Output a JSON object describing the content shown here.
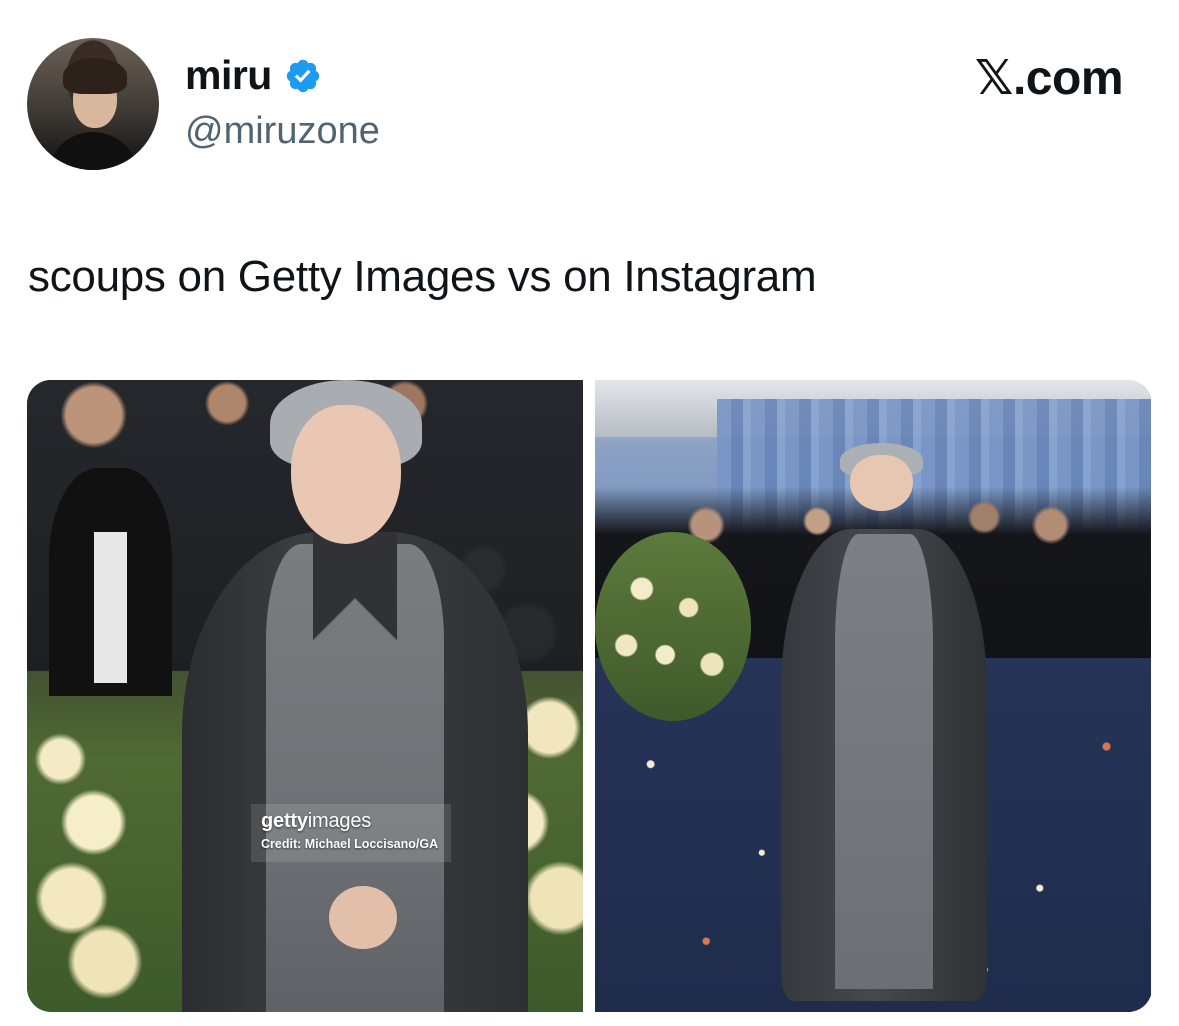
{
  "author": {
    "display_name": "miru",
    "handle": "@miruzone",
    "verified": true,
    "verified_color": "#1d9bf0"
  },
  "site": {
    "mark": "𝕏.com"
  },
  "tweet": {
    "text": "scoups on Getty Images vs on Instagram"
  },
  "media": {
    "left_photo": {
      "watermark_brand_bold": "getty",
      "watermark_brand_light": "images",
      "watermark_credit": "Credit: Michael Loccisano/GA"
    }
  },
  "colors": {
    "text_primary": "#0f1419",
    "text_secondary": "#536471",
    "background": "#ffffff"
  },
  "icons": {
    "verified": "verified-badge-icon"
  }
}
